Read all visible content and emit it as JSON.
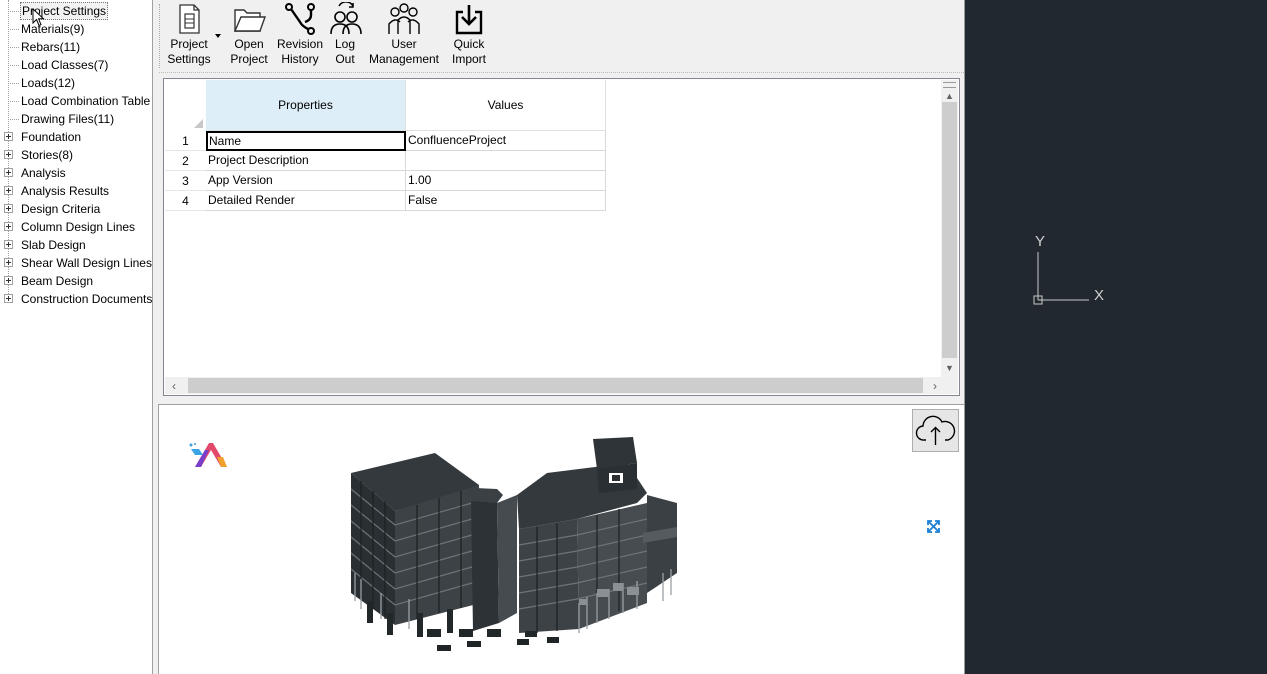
{
  "tree": {
    "items": [
      {
        "label": "Project Settings",
        "expandable": false,
        "selected": true
      },
      {
        "label": "Materials(9)",
        "expandable": false
      },
      {
        "label": "Rebars(11)",
        "expandable": false
      },
      {
        "label": "Load Classes(7)",
        "expandable": false
      },
      {
        "label": "Loads(12)",
        "expandable": false
      },
      {
        "label": "Load Combination Table",
        "expandable": false
      },
      {
        "label": "Drawing Files(11)",
        "expandable": false
      },
      {
        "label": "Foundation",
        "expandable": true
      },
      {
        "label": "Stories(8)",
        "expandable": true
      },
      {
        "label": "Analysis",
        "expandable": true
      },
      {
        "label": "Analysis Results",
        "expandable": true
      },
      {
        "label": "Design Criteria",
        "expandable": true
      },
      {
        "label": "Column Design Lines",
        "expandable": true
      },
      {
        "label": "Slab Design",
        "expandable": true
      },
      {
        "label": "Shear Wall Design Lines",
        "expandable": true
      },
      {
        "label": "Beam Design",
        "expandable": true
      },
      {
        "label": "Construction Documents",
        "expandable": true
      }
    ]
  },
  "toolbar": {
    "project_settings": "Project\nSettings",
    "open_project": "Open\nProject",
    "revision_history": "Revision\nHistory",
    "log_out": "Log\nOut",
    "user_management": "User\nManagement",
    "quick_import": "Quick\nImport"
  },
  "grid": {
    "columns": [
      "Properties",
      "Values"
    ],
    "rows": [
      {
        "num": "1",
        "property": "Name",
        "value": "ConfluenceProject"
      },
      {
        "num": "2",
        "property": "Project Description",
        "value": ""
      },
      {
        "num": "3",
        "property": "App Version",
        "value": "1.00"
      },
      {
        "num": "4",
        "property": "Detailed Render",
        "value": "False"
      }
    ]
  },
  "cad": {
    "axis_y": "Y",
    "axis_x": "X"
  },
  "colors": {
    "cad_background": "#212830",
    "header_highlight": "#ddeef8",
    "expand_icon": "#1a7fd4"
  }
}
